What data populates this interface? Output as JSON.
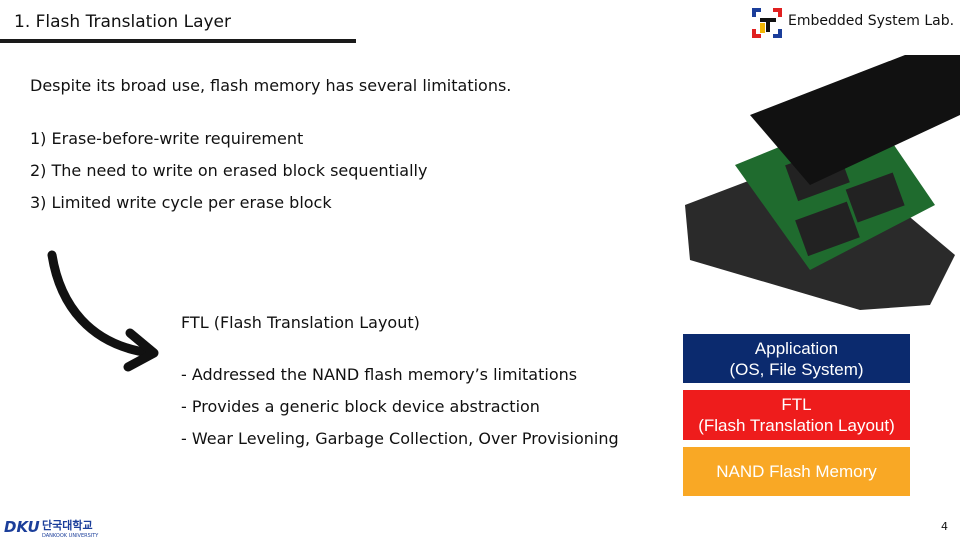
{
  "header": {
    "title": "1. Flash Translation Layer",
    "lab_name": "Embedded System Lab."
  },
  "intro": "Despite its broad use, flash memory has several limitations.",
  "limitations": [
    "1)  Erase-before-write requirement",
    "2)  The need to write on erased block sequentially",
    "3)  Limited write cycle per erase block"
  ],
  "ftl": {
    "heading": "FTL (Flash Translation Layout)",
    "bullets": [
      "-  Addressed the NAND flash memory’s limitations",
      "-  Provides a generic block device abstraction",
      "-  Wear Leveling, Garbage Collection, Over Provisioning"
    ]
  },
  "stack": {
    "app_line1": "Application",
    "app_line2": "(OS, File System)",
    "ftl_line1": "FTL",
    "ftl_line2": "(Flash Translation Layout)",
    "nand": "NAND Flash Memory"
  },
  "colors": {
    "app": "#0b2a6e",
    "ftl": "#ee1c1c",
    "nand": "#f9a825"
  },
  "footer": {
    "university_logo": "DKU 단국대학교 DANKOOK UNIVERSITY",
    "page": "4"
  }
}
